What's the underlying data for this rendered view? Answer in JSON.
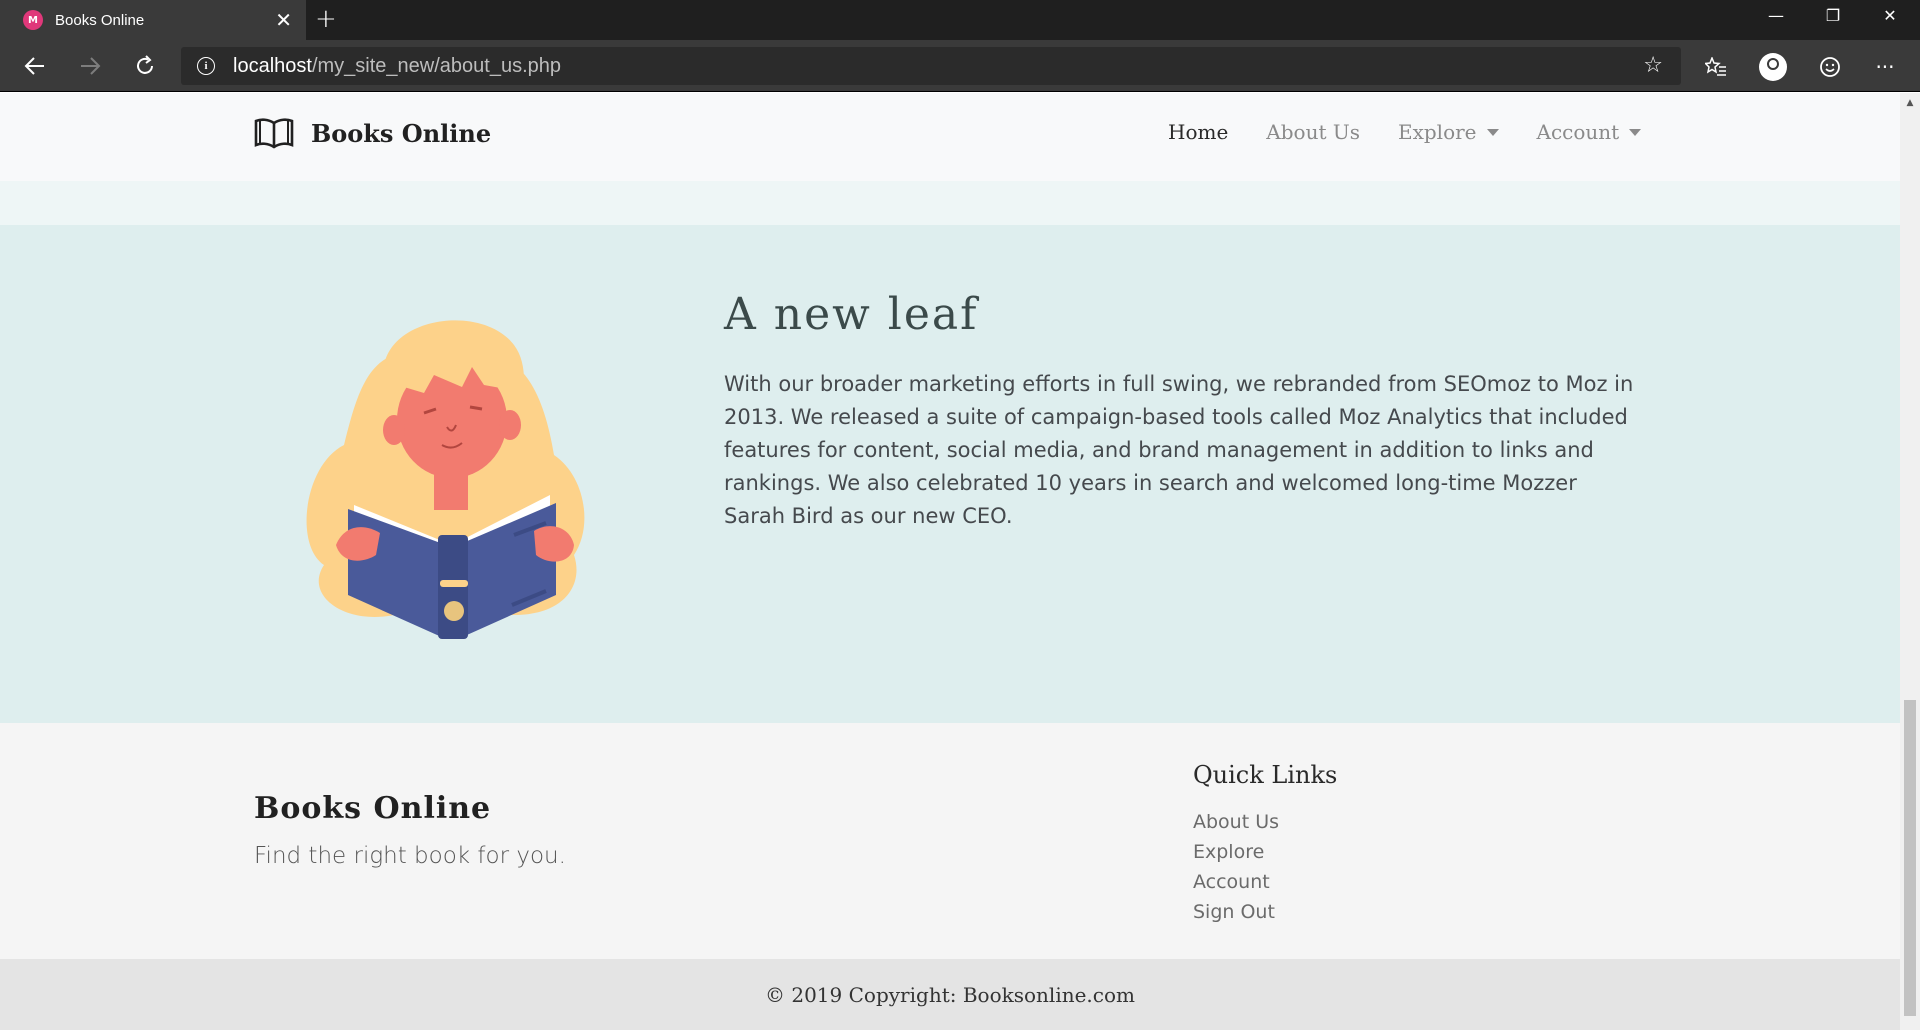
{
  "browser": {
    "tab_title": "Books Online",
    "tab_close": "✕",
    "new_tab": "+",
    "window_controls": {
      "minimize": "—",
      "restore": "❐",
      "close": "✕"
    },
    "url_host": "localhost",
    "url_path": "/my_site_new/about_us.php",
    "icons": [
      "back-arrow-icon",
      "forward-arrow-icon",
      "refresh-icon",
      "info-icon",
      "star-icon",
      "favorites-icon",
      "profile-icon",
      "smiley-icon",
      "more-icon"
    ]
  },
  "nav": {
    "brand": "Books Online",
    "items": [
      {
        "label": "Home",
        "active": true,
        "dropdown": false
      },
      {
        "label": "About Us",
        "active": false,
        "dropdown": false
      },
      {
        "label": "Explore",
        "active": false,
        "dropdown": true
      },
      {
        "label": "Account",
        "active": false,
        "dropdown": true
      }
    ]
  },
  "hero": {
    "title": "A new leaf",
    "body": "With our broader marketing efforts in full swing, we rebranded from SEOmoz to Moz in 2013. We released a suite of campaign-based tools called Moz Analytics that included features for content, social media, and brand management in addition to links and rankings. We also celebrated 10 years in search and welcomed long-time Mozzer Sarah Bird as our new CEO."
  },
  "footer": {
    "brand": "Books Online",
    "tagline": "Find the right book for you.",
    "quick_links_title": "Quick Links",
    "quick_links": [
      "About Us",
      "Explore",
      "Account",
      "Sign Out"
    ],
    "copyright": "© 2019 Copyright: Booksonline.com"
  },
  "colors": {
    "hero_bg": "#deeeee",
    "footer_bg": "#f5f5f5",
    "copyright_bg": "#e4e4e4",
    "book_blue": "#4a5a9a",
    "hair_yellow": "#fdd28a",
    "skin_coral": "#f27b6f"
  }
}
